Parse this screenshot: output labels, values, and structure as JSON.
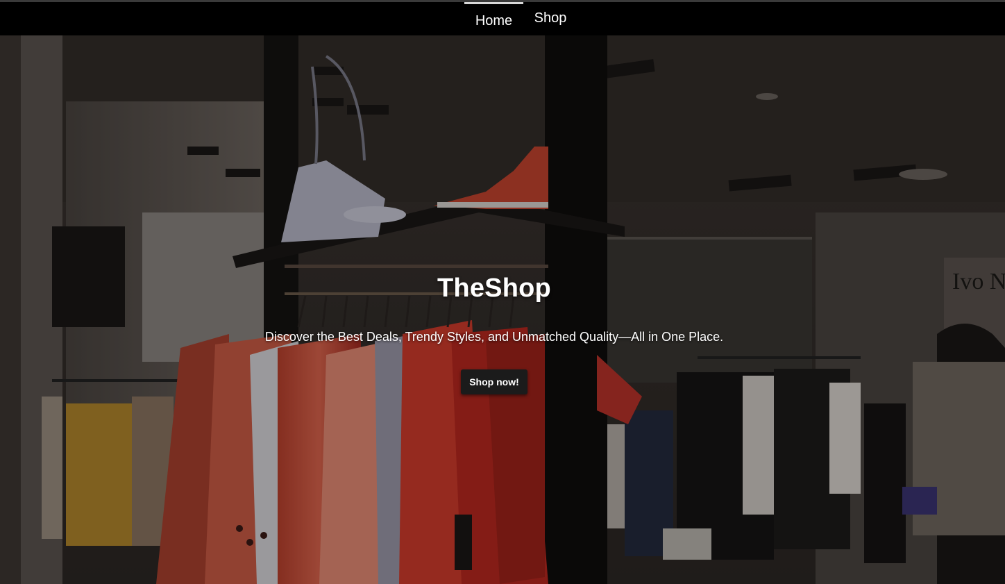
{
  "nav": {
    "items": [
      {
        "label": "Home",
        "active": true
      },
      {
        "label": "Shop",
        "active": false
      }
    ]
  },
  "hero": {
    "title": "TheShop",
    "subtitle": "Discover the Best Deals, Trendy Styles, and Unmatched Quality—All in One Place.",
    "cta_label": "Shop now!",
    "background_image": "clothing-store-interior-photo",
    "storefront_sign": "Ivo Ni"
  },
  "colors": {
    "nav_background": "#000000",
    "active_tab_indicator": "#d9d9d9",
    "button_background": "#1b1b1b",
    "text": "#ffffff"
  }
}
